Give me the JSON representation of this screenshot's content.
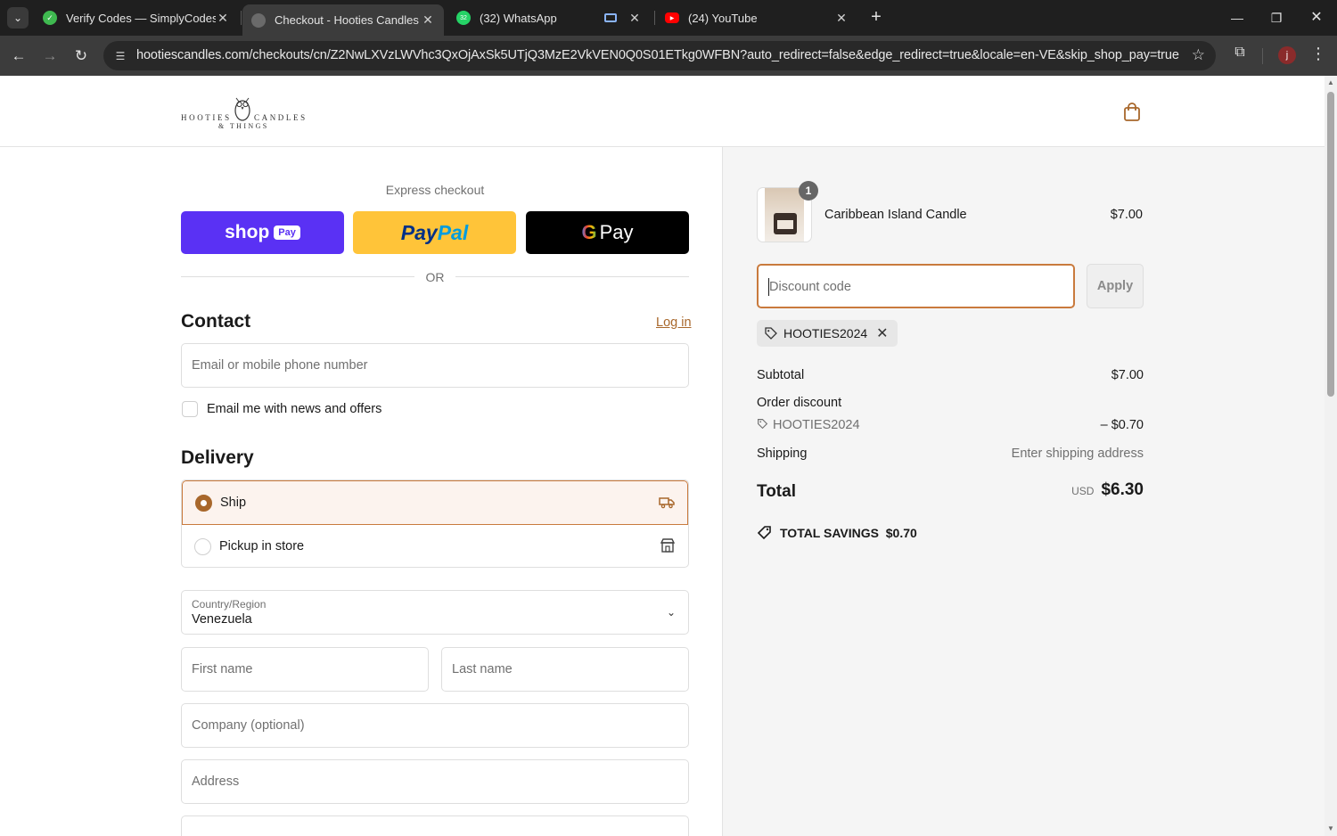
{
  "browser": {
    "tabs": [
      {
        "title": "Verify Codes — SimplyCodes",
        "favicon": "simplycodes-icon"
      },
      {
        "title": "Checkout - Hooties Candles",
        "favicon": "globe-icon"
      },
      {
        "title": "(32) WhatsApp",
        "favicon": "whatsapp-icon",
        "badge": "32"
      },
      {
        "title": "(24) YouTube",
        "favicon": "youtube-icon"
      }
    ],
    "url": "hootiescandles.com/checkouts/cn/Z2NwLXVzLWVhc3QxOjAxSk5UTjQ3MzE2VkVEN0Q0S01ETkg0WFBN?auto_redirect=false&edge_redirect=true&locale=en-VE&skip_shop_pay=true",
    "profile_initial": "j"
  },
  "brand": {
    "logo_left": "HOOTIES",
    "logo_right": "CANDLES",
    "logo_bottom": "& THINGS",
    "accent": "#a8672b"
  },
  "checkout": {
    "express_label": "Express checkout",
    "shop_pay": {
      "shop": "shop",
      "pay": "Pay"
    },
    "paypal": {
      "p1": "Pay",
      "p2": "Pal"
    },
    "gpay": {
      "g": "G",
      "pay": "Pay"
    },
    "or": "OR",
    "contact": {
      "title": "Contact",
      "login": "Log in",
      "email_placeholder": "Email or mobile phone number",
      "newsletter_label": "Email me with news and offers"
    },
    "delivery": {
      "title": "Delivery",
      "ship": "Ship",
      "pickup": "Pickup in store",
      "country_label": "Country/Region",
      "country_value": "Venezuela",
      "first_name": "First name",
      "last_name": "Last name",
      "company": "Company (optional)",
      "address": "Address"
    }
  },
  "order": {
    "item": {
      "name": "Caribbean Island Candle",
      "price": "$7.00",
      "qty": "1"
    },
    "discount_placeholder": "Discount code",
    "apply": "Apply",
    "applied_code": "HOOTIES2024",
    "subtotal_label": "Subtotal",
    "subtotal": "$7.00",
    "order_discount_label": "Order discount",
    "discount_code": "HOOTIES2024",
    "discount_amount": "– $0.70",
    "shipping_label": "Shipping",
    "shipping_value": "Enter shipping address",
    "total_label": "Total",
    "currency": "USD",
    "total": "$6.30",
    "savings_label": "TOTAL SAVINGS",
    "savings": "$0.70"
  }
}
